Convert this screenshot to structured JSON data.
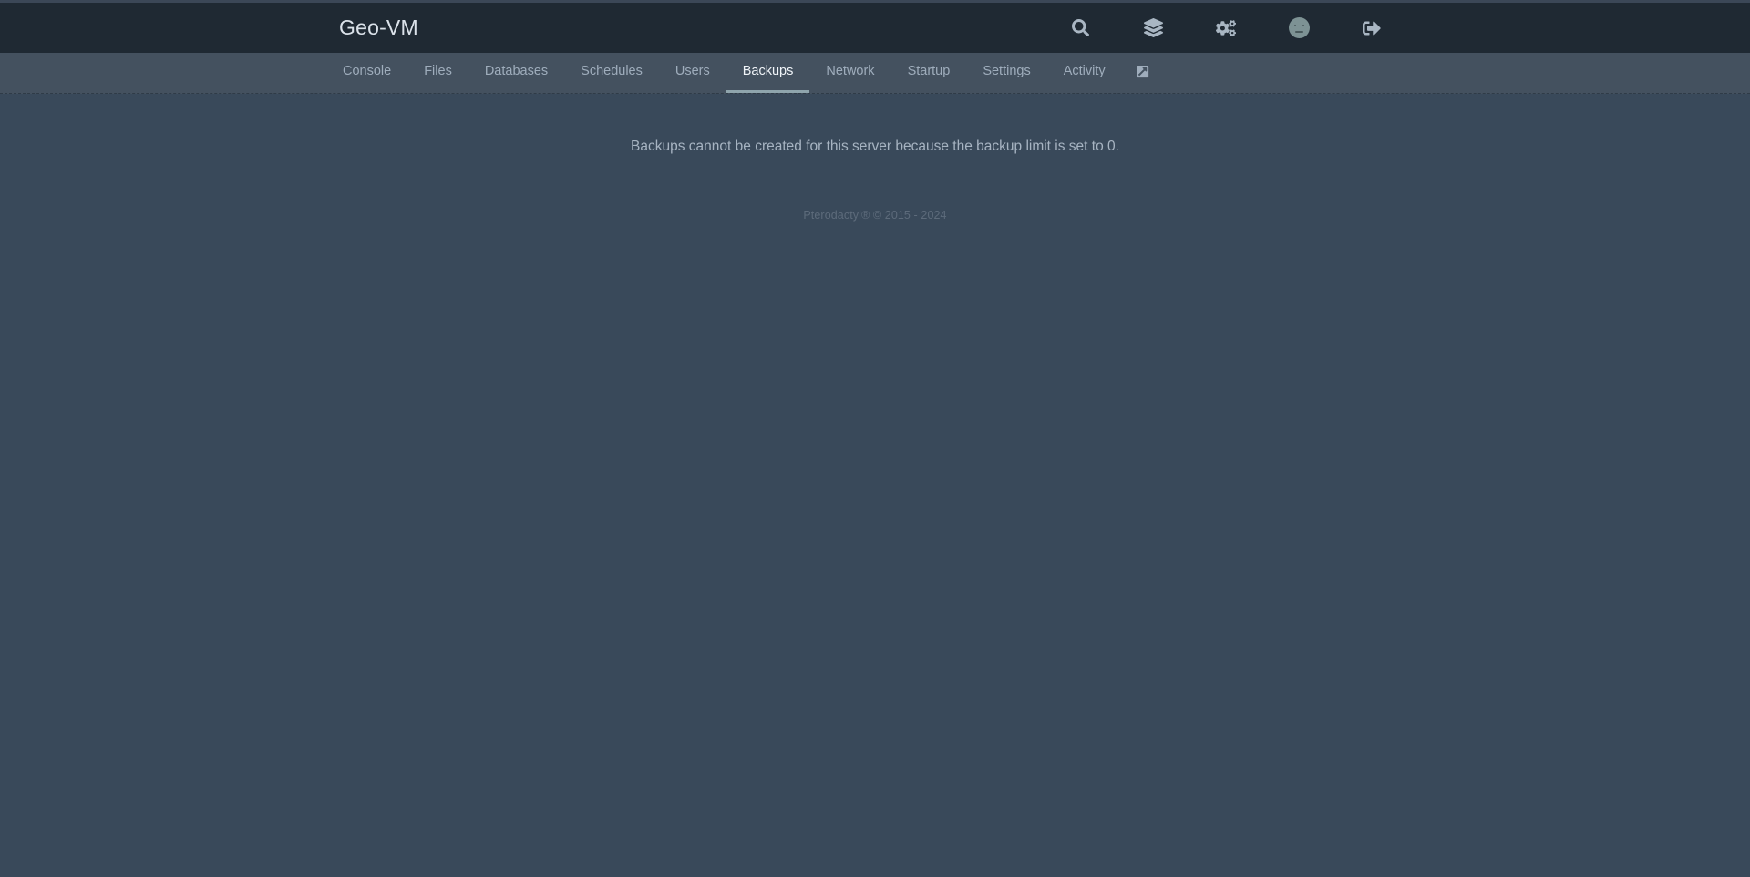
{
  "theme": {
    "header_bg": "#1f2933",
    "subnav_bg": "#44515f",
    "body_bg": "#39495a",
    "text_muted": "#9fadbc",
    "text_active": "#f0f4f8",
    "accent_underline": "#8fa5ad",
    "footer_text": "#5d6b7b",
    "avatar_bg": "#7d9294"
  },
  "header": {
    "brand": "Geo-VM",
    "icons": [
      {
        "name": "search-icon",
        "label": "Search"
      },
      {
        "name": "layers-icon",
        "label": "Servers"
      },
      {
        "name": "cogs-icon",
        "label": "Admin"
      },
      {
        "name": "avatar",
        "label": "Account"
      },
      {
        "name": "sign-out-icon",
        "label": "Sign Out"
      }
    ]
  },
  "subnav": {
    "items": [
      {
        "label": "Console",
        "active": false
      },
      {
        "label": "Files",
        "active": false
      },
      {
        "label": "Databases",
        "active": false
      },
      {
        "label": "Schedules",
        "active": false
      },
      {
        "label": "Users",
        "active": false
      },
      {
        "label": "Backups",
        "active": true
      },
      {
        "label": "Network",
        "active": false
      },
      {
        "label": "Startup",
        "active": false
      },
      {
        "label": "Settings",
        "active": false
      },
      {
        "label": "Activity",
        "active": false
      }
    ],
    "external_link_icon": "external-link-icon"
  },
  "main": {
    "empty_message": "Backups cannot be created for this server because the backup limit is set to 0."
  },
  "footer": {
    "copyright": "Pterodactyl® © 2015 - 2024"
  }
}
